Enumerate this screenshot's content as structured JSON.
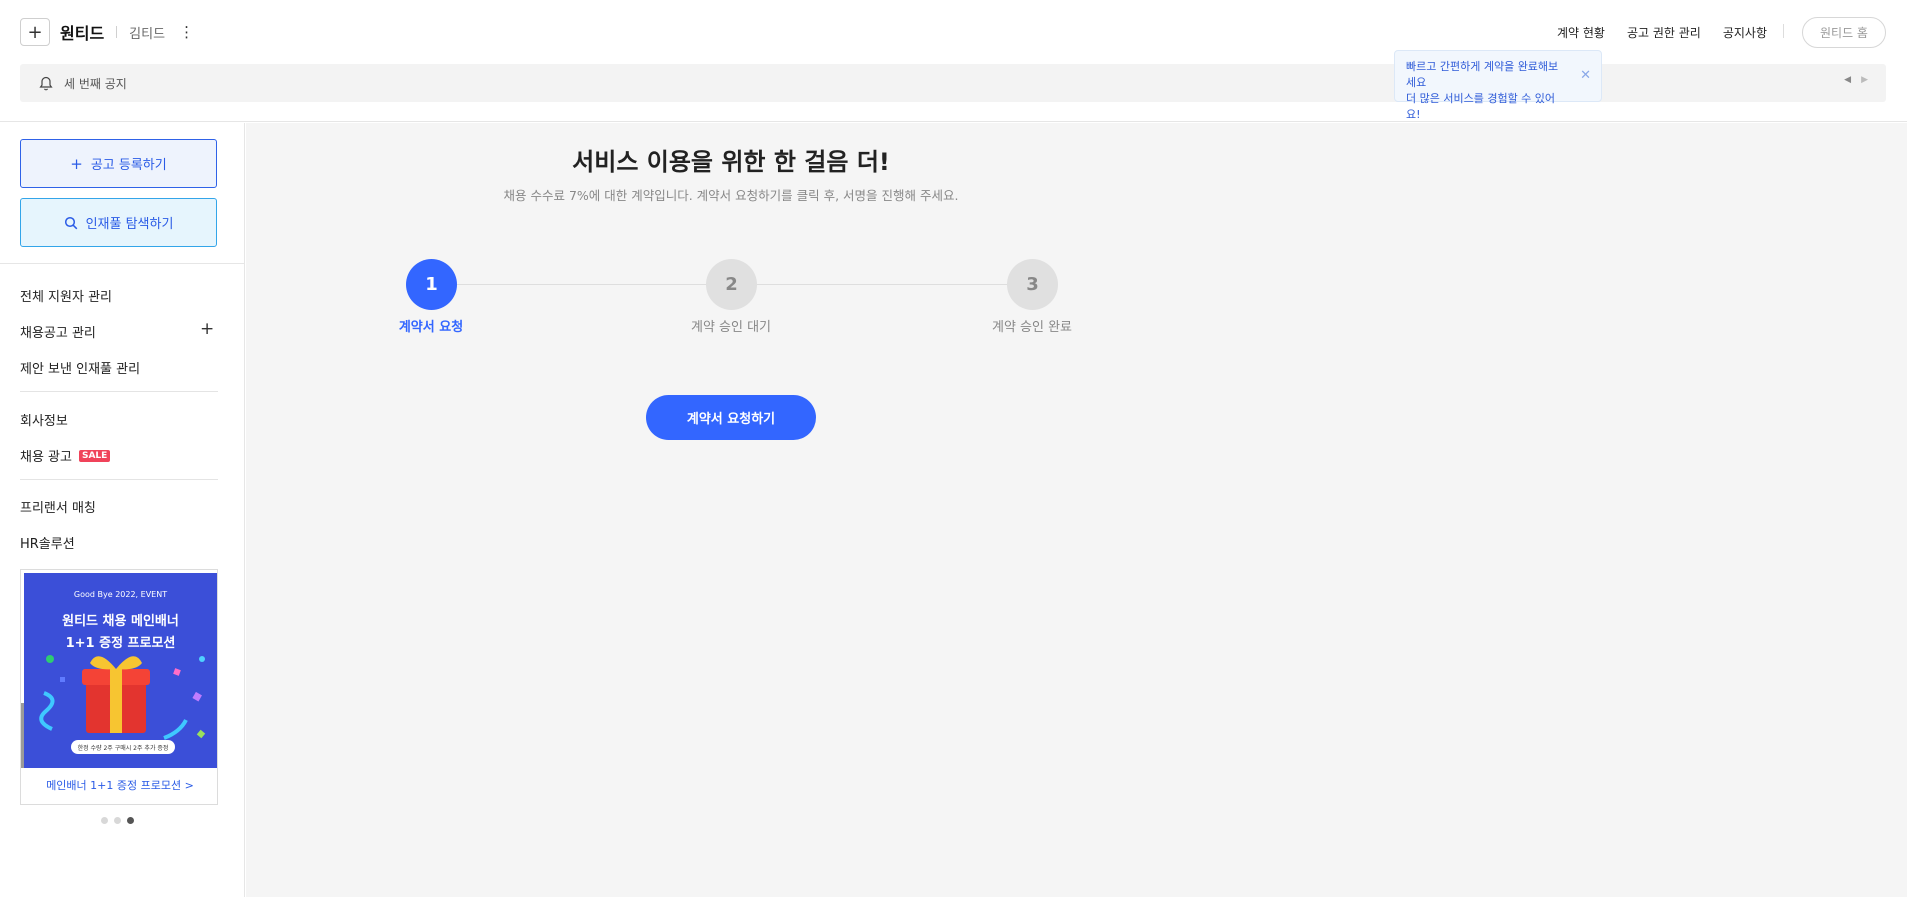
{
  "header": {
    "brand": "원티드",
    "company": "김티드",
    "nav": [
      "계약 현황",
      "공고 권한 관리",
      "공지사항"
    ],
    "home_button": "원티드 홈",
    "notice": "세 번째 공지",
    "tooltip_line1": "빠르고 간편하게 계약을 완료해보세요",
    "tooltip_line2": "더 많은 서비스를 경험할 수 있어요!"
  },
  "sidebar": {
    "post_button": "공고 등록하기",
    "talent_button": "인재풀 탐색하기",
    "menu": {
      "applicants": "전체 지원자 관리",
      "job_posts": "채용공고 관리",
      "proposals": "제안 보낸 인재풀 관리",
      "company_info": "회사정보",
      "recruit_ads": "채용 광고",
      "sale_badge": "SALE",
      "freelancer": "프리랜서 매칭",
      "hr_solution": "HR솔루션"
    },
    "banner": {
      "event": "Good Bye 2022, EVENT",
      "title_line1": "원티드 채용 메인배너",
      "title_line2": "1+1 증정 프로모션",
      "pill": "한정 수량 2주 구매시 2주 추가 증정",
      "caption": "메인배너 1+1 증정 프로모션 >"
    }
  },
  "main": {
    "title": "서비스 이용을 위한 한 걸음 더!",
    "subtitle": "채용 수수료 7%에 대한 계약입니다. 계약서 요청하기를 클릭 후, 서명을 진행해 주세요.",
    "steps": [
      {
        "num": "1",
        "label": "계약서 요청"
      },
      {
        "num": "2",
        "label": "계약 승인 대기"
      },
      {
        "num": "3",
        "label": "계약 승인 완료"
      }
    ],
    "request_button": "계약서 요청하기"
  },
  "colors": {
    "accent": "#3366ff",
    "sale": "#f0435a",
    "banner": "#3b4fd8"
  }
}
